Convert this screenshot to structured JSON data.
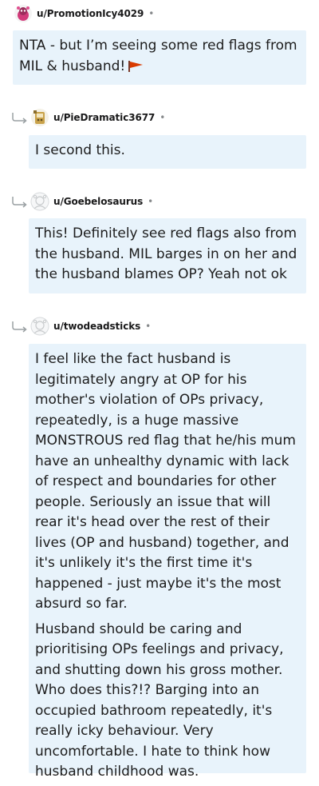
{
  "comments": [
    {
      "username": "u/PromotionIcy4029",
      "separator": "•",
      "avatar_icon": "snoo-avatar-pink-icon",
      "paragraphs": [
        "NTA - but I’m seeing some red flags from MIL & husband!"
      ],
      "emoji": "red-triangular-flag-icon"
    },
    {
      "username": "u/PieDramatic3677",
      "separator": "•",
      "avatar_icon": "snoo-avatar-gold-icon",
      "paragraphs": [
        "I second this."
      ]
    },
    {
      "username": "u/Goebelosaurus",
      "separator": "•",
      "avatar_icon": "default-avatar-icon",
      "paragraphs": [
        "This! Definitely see red flags also from the husband. MIL barges in on her and the husband blames OP? Yeah not ok"
      ]
    },
    {
      "username": "u/twodeadsticks",
      "separator": "•",
      "avatar_icon": "default-avatar-icon",
      "paragraphs": [
        "I feel like the fact husband is legitimately angry at OP for his mother's violation of OPs privacy, repeatedly, is a huge massive MONSTROUS red flag that he/his mum have an unhealthy dynamic with lack of respect and boundaries for other people. Seriously an issue that will rear it's head over the rest of their lives (OP and husband) together, and it's unlikely it's the first time it's happened - just maybe it's the most absurd so far.",
        "Husband should be caring and prioritising OPs feelings and privacy, and shutting down his gross mother. Who does this?!? Barging into an occupied bathroom repeatedly, it's really icky behaviour. Very uncomfortable. I hate to think how husband childhood was."
      ]
    }
  ],
  "colors": {
    "bubble_bg": "#e8f3fb",
    "text": "#1c1c1c",
    "muted": "#878a8c",
    "flag_red": "#d93a00"
  }
}
